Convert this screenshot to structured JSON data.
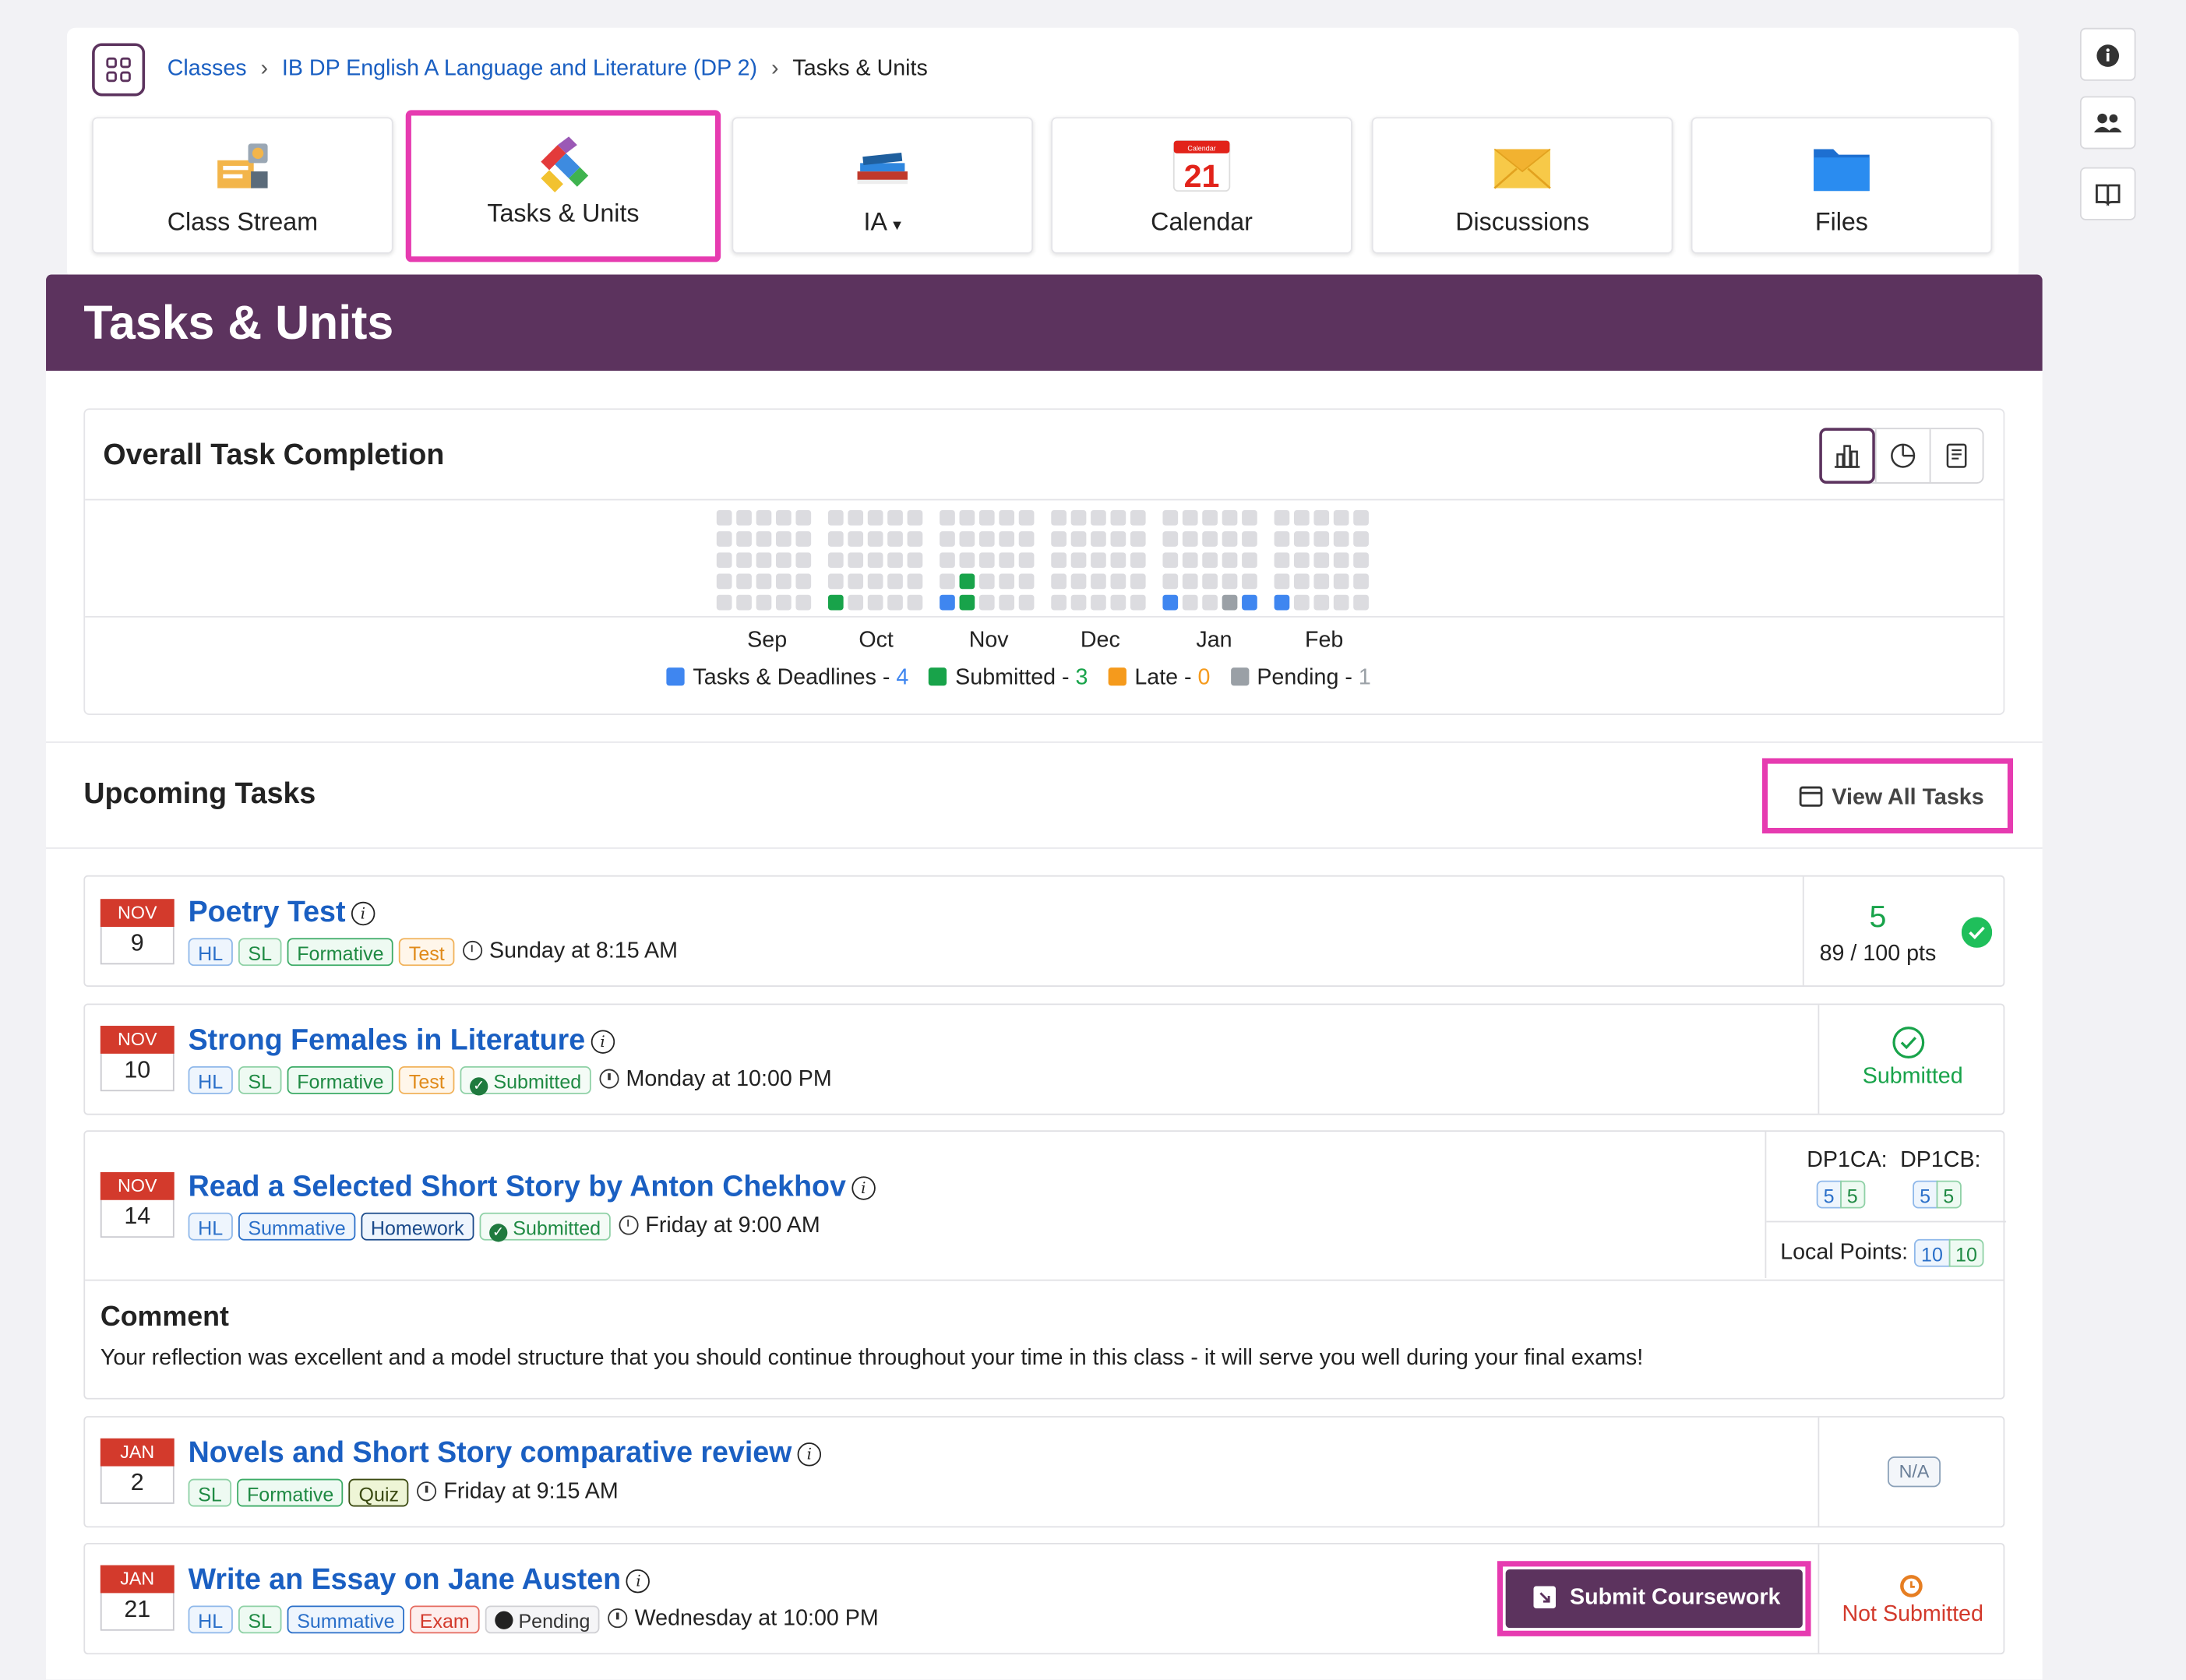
{
  "breadcrumb": {
    "classes": "Classes",
    "course": "IB DP English A Language and Literature (DP 2)",
    "current": "Tasks & Units"
  },
  "nav_tabs": [
    {
      "label": "Class Stream",
      "icon": "class-stream-icon"
    },
    {
      "label": "Tasks & Units",
      "icon": "puzzle-icon",
      "active": true
    },
    {
      "label": "IA",
      "icon": "books-icon",
      "dropdown": true
    },
    {
      "label": "Calendar",
      "icon": "calendar-icon",
      "day": "21",
      "mini": "Calendar"
    },
    {
      "label": "Discussions",
      "icon": "envelope-icon"
    },
    {
      "label": "Files",
      "icon": "folder-icon"
    }
  ],
  "page_title": "Tasks & Units",
  "completion": {
    "title": "Overall Task Completion",
    "months": [
      "Sep",
      "Oct",
      "Nov",
      "Dec",
      "Jan",
      "Feb"
    ],
    "legend": [
      {
        "label": "Tasks & Deadlines",
        "count": "4",
        "color": "#3f86f0"
      },
      {
        "label": "Submitted",
        "count": "3",
        "color": "#18a34a"
      },
      {
        "label": "Late",
        "count": "0",
        "color": "#f59a1c"
      },
      {
        "label": "Pending",
        "count": "1",
        "color": "#9aa0a6"
      }
    ]
  },
  "chart_data": {
    "type": "heatmap",
    "title": "Overall Task Completion",
    "months": [
      "Sep",
      "Oct",
      "Nov",
      "Dec",
      "Jan",
      "Feb"
    ],
    "totals": {
      "Tasks & Deadlines": 4,
      "Submitted": 3,
      "Late": 0,
      "Pending": 1
    },
    "colored_cells": [
      {
        "month": "Oct",
        "status": "Submitted"
      },
      {
        "month": "Nov",
        "status": "Tasks & Deadlines"
      },
      {
        "month": "Nov",
        "status": "Submitted"
      },
      {
        "month": "Nov",
        "status": "Submitted"
      },
      {
        "month": "Jan",
        "status": "Tasks & Deadlines"
      },
      {
        "month": "Jan",
        "status": "Pending"
      },
      {
        "month": "Jan",
        "status": "Tasks & Deadlines"
      },
      {
        "month": "Feb",
        "status": "Tasks & Deadlines"
      }
    ]
  },
  "upcoming": {
    "title": "Upcoming Tasks",
    "view_all": "View All Tasks"
  },
  "tasks": [
    {
      "month": "NOV",
      "day": "9",
      "title": "Poetry Test",
      "tags": [
        "HL",
        "SL",
        "Formative",
        "Test"
      ],
      "due": "Sunday at 8:15 AM",
      "score": "5",
      "points": "89 / 100 pts"
    },
    {
      "month": "NOV",
      "day": "10",
      "title": "Strong Females in Literature",
      "tags": [
        "HL",
        "SL",
        "Formative",
        "Test",
        "Submitted"
      ],
      "due": "Monday at 10:00 PM",
      "status": "Submitted"
    },
    {
      "month": "NOV",
      "day": "14",
      "title": "Read a Selected Short Story by Anton Chekhov",
      "tags": [
        "HL",
        "Summative",
        "Homework",
        "Submitted"
      ],
      "due": "Friday at 9:00 AM",
      "grades": {
        "c1_label": "DP1CA:",
        "c1": [
          "5",
          "5"
        ],
        "c2_label": "DP1CB:",
        "c2": [
          "5",
          "5"
        ],
        "local_label": "Local Points:",
        "local": [
          "10",
          "10"
        ]
      },
      "comment_title": "Comment",
      "comment": "Your reflection was excellent and a model structure that you should continue throughout your time in this class - it will serve you well during your final exams!"
    },
    {
      "month": "JAN",
      "day": "2",
      "title": "Novels and Short Story comparative review",
      "tags": [
        "SL",
        "Formative",
        "Quiz"
      ],
      "due": "Friday at 9:15 AM",
      "status": "N/A"
    },
    {
      "month": "JAN",
      "day": "21",
      "title": "Write an Essay on Jane Austen",
      "tags": [
        "HL",
        "SL",
        "Summative",
        "Exam",
        "Pending"
      ],
      "due": "Wednesday at 10:00 PM",
      "button": "Submit Coursework",
      "status": "Not Submitted"
    }
  ]
}
